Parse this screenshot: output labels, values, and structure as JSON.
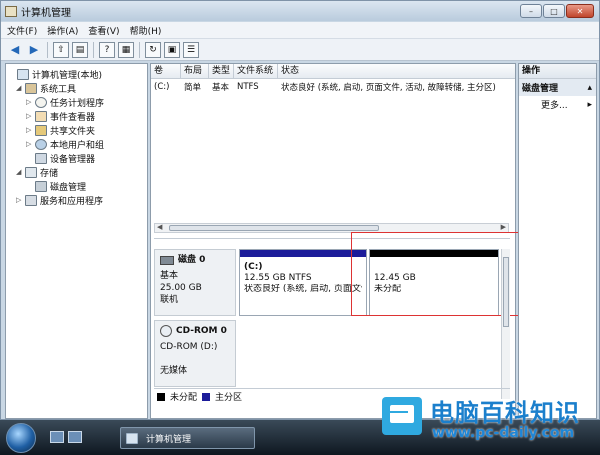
{
  "window": {
    "title": "计算机管理",
    "buttons": {
      "minimize": "–",
      "maximize": "□",
      "close": "✕"
    }
  },
  "menu": [
    "文件(F)",
    "操作(A)",
    "查看(V)",
    "帮助(H)"
  ],
  "tree": [
    {
      "label": "计算机管理(本地)",
      "icon": "computer-icon",
      "level": 0,
      "expander": ""
    },
    {
      "label": "系统工具",
      "icon": "tools-icon",
      "level": 1,
      "expander": "◢"
    },
    {
      "label": "任务计划程序",
      "icon": "clock-icon",
      "level": 2,
      "expander": "▷"
    },
    {
      "label": "事件查看器",
      "icon": "event-icon",
      "level": 2,
      "expander": "▷"
    },
    {
      "label": "共享文件夹",
      "icon": "share-icon",
      "level": 2,
      "expander": "▷"
    },
    {
      "label": "本地用户和组",
      "icon": "users-icon",
      "level": 2,
      "expander": "▷"
    },
    {
      "label": "设备管理器",
      "icon": "device-icon",
      "level": 2,
      "expander": ""
    },
    {
      "label": "存储",
      "icon": "storage-icon",
      "level": 1,
      "expander": "◢"
    },
    {
      "label": "磁盘管理",
      "icon": "disk-icon",
      "level": 2,
      "expander": ""
    },
    {
      "label": "服务和应用程序",
      "icon": "services-icon",
      "level": 1,
      "expander": "▷"
    }
  ],
  "volume_table": {
    "headers": [
      "卷",
      "布局",
      "类型",
      "文件系统",
      "状态"
    ],
    "rows": [
      [
        "(C:)",
        "简单",
        "基本",
        "NTFS",
        "状态良好 (系统, 启动, 页面文件, 活动, 故障转储, 主分区)"
      ]
    ]
  },
  "disks": [
    {
      "name": "磁盘 0",
      "type": "基本",
      "size": "25.00 GB",
      "status": "联机",
      "partitions": [
        {
          "label": "(C:)",
          "size": "12.55 GB NTFS",
          "status": "状态良好 (系统, 启动, 页面文件",
          "bar_color": "#1c1c9a"
        },
        {
          "label": "",
          "size": "12.45 GB",
          "status": "未分配",
          "bar_color": "#000000"
        }
      ]
    },
    {
      "name": "CD-ROM 0",
      "type": "CD-ROM (D:)",
      "size": "",
      "status": "无媒体",
      "partitions": []
    }
  ],
  "legend": [
    {
      "label": "未分配",
      "color": "#000000"
    },
    {
      "label": "主分区",
      "color": "#1c1c9a"
    }
  ],
  "actions": {
    "header": "操作",
    "section": "磁盘管理",
    "more": "更多..."
  },
  "taskbar": {
    "window_button": "计算机管理"
  },
  "watermark": {
    "title": "电脑百科知识",
    "url": "www.pc-daily.com"
  }
}
